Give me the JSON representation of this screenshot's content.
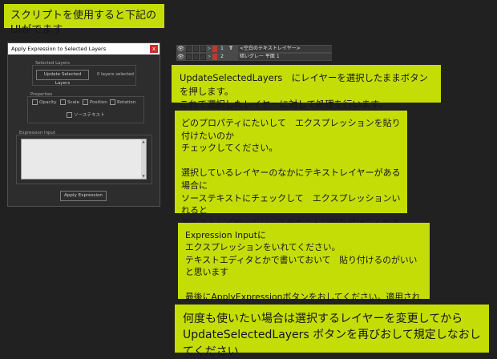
{
  "title_note": "スクリプトを使用すると下記のUIがでます",
  "dialog": {
    "title": "Apply Expression to Selected Layers",
    "close_label": "x",
    "selected_layers": {
      "group_label": "Selected Layers",
      "update_button": "Update Selected Layers",
      "status": "0 layers selected"
    },
    "properties": {
      "group_label": "Properties",
      "checkboxes": [
        "Opacity",
        "Scale",
        "Position",
        "Rotation",
        "ソーステキスト"
      ]
    },
    "expression_input": {
      "group_label": "Expression Input",
      "value": ""
    },
    "apply_button": "Apply Expression"
  },
  "layers": [
    {
      "number": "1",
      "type_icon": "T",
      "name": "<空白のテキストレイヤー>"
    },
    {
      "number": "2",
      "type_icon": "",
      "name": "暗いグレー 平面 1"
    }
  ],
  "notes": {
    "n1": "UpdateSelectedLayers　にレイヤーを選択したままボタンを押します。\nこれで選択したレイヤーに対して処理を行います。",
    "n2": "どのプロパティにたいして　エクスプレッションを貼り付けたいのか\nチェックしてください。\n\n選択しているレイヤーのなかにテキストレイヤーがある場合に\nソーステキストにチェックして　エクスプレッションいれると\nテキストレイヤーのソーステキストに貼り付けてくれます\n※日本語しか対応していません。",
    "n3": "Expression Inputに\nエクスプレッションをいれてください。\nテキストエディタとかで書いておいて　貼り付けるのがいいと思います\n\n最後にApplyExpressionボタンをおしてください。適用されます。",
    "n4": "何度も使いたい場合は選択するレイヤーを変更してから\nUpdateSelectedLayers ボタンを再びおして規定しなおしてください"
  },
  "colors": {
    "note_bg": "#c5dd06",
    "page_bg": "#212121",
    "close_red": "#c9302c"
  }
}
